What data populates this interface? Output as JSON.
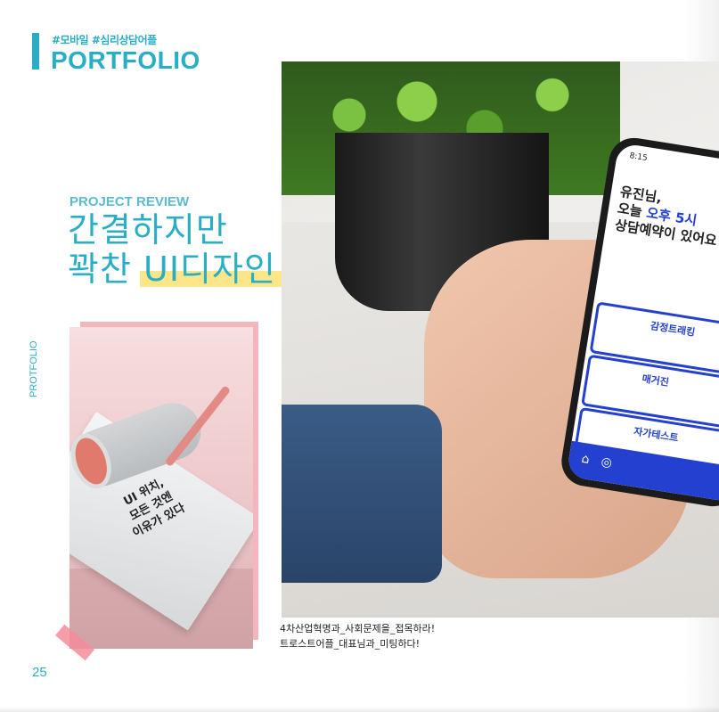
{
  "header": {
    "tags": "#모바일 #심리상담어플",
    "title": "PORTFOLIO"
  },
  "review": {
    "label": "PROJECT REVIEW",
    "line1": "간결하지만",
    "line2_prefix": "꽉찬 ",
    "line2_highlight": "UI디자인"
  },
  "side_label": "PROTFOLIO",
  "note_photo": {
    "text": [
      "UI 위치,",
      "모든 것엔",
      "이유가 있다"
    ]
  },
  "phone": {
    "time": "8:15",
    "greeting": [
      "유진님,",
      "오늘 ",
      "오후 5시",
      "상담예약이 있어요"
    ],
    "cards": [
      "감정트래킹",
      "매거진",
      "자가테스트"
    ]
  },
  "caption": [
    "4차산업혁명과_사회문제을_접목하라!",
    "트로스트어플_대표님과_미팅하다!"
  ],
  "page_number": "25",
  "colors": {
    "accent": "#2aaec6",
    "highlight": "#fde68a",
    "pink": "#f5b5bd",
    "app_blue": "#2340d0"
  }
}
